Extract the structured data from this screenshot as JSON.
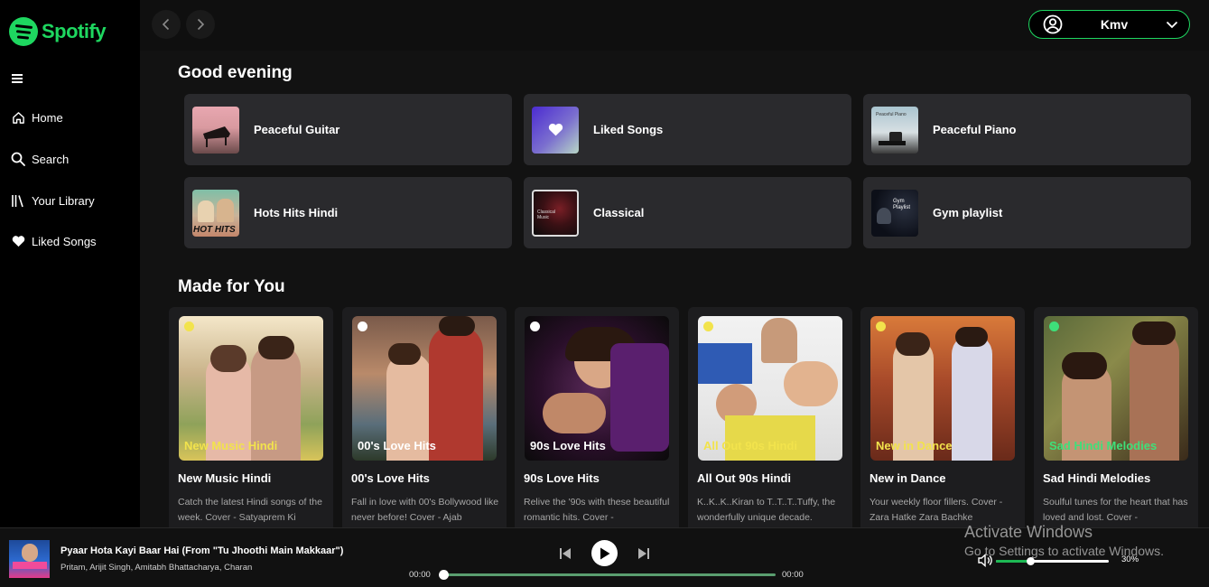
{
  "brand": {
    "name": "Spotify",
    "accent": "#1ed760"
  },
  "sidebar": {
    "items": [
      {
        "label": "Home",
        "icon": "home-icon"
      },
      {
        "label": "Search",
        "icon": "search-icon"
      },
      {
        "label": "Your Library",
        "icon": "library-icon"
      },
      {
        "label": "Liked Songs",
        "icon": "heart-icon"
      }
    ]
  },
  "header": {
    "user_name": "Kmv"
  },
  "greeting": "Good evening",
  "quick_picks": [
    {
      "label": "Peaceful Guitar"
    },
    {
      "label": "Liked Songs"
    },
    {
      "label": "Peaceful Piano",
      "art_text": "Peaceful Piano"
    },
    {
      "label": "Hots Hits Hindi",
      "art_text": "HOT HITS"
    },
    {
      "label": "Classical",
      "art_text": "Classical Music"
    },
    {
      "label": "Gym playlist",
      "art_text": "Gym Playlist"
    }
  ],
  "made_for_you": {
    "title": "Made for You",
    "cards": [
      {
        "title": "New Music Hindi",
        "overlay": "New Music Hindi",
        "overlay_color": "#f2e34c",
        "desc": "Catch the latest Hindi songs of the week. Cover - Satyaprem Ki"
      },
      {
        "title": "00's Love Hits",
        "overlay": "00's Love Hits",
        "overlay_color": "#ffffff",
        "desc": "Fall in love with 00's Bollywood like never before! Cover - Ajab"
      },
      {
        "title": "90s Love Hits",
        "overlay": "90s Love Hits",
        "overlay_color": "#ffffff",
        "desc": "Relive the '90s with these beautiful romantic hits. Cover -"
      },
      {
        "title": "All Out 90s Hindi",
        "overlay": "All Out 90s Hindi",
        "overlay_color": "#f2e34c",
        "desc": "K..K..K..Kiran to T..T..T..Tuffy, the wonderfully unique decade."
      },
      {
        "title": "New in Dance",
        "overlay": "New in Dance",
        "overlay_color": "#f2e34c",
        "desc": "Your weekly floor fillers. Cover - Zara Hatke Zara Bachke"
      },
      {
        "title": "Sad Hindi Melodies",
        "overlay": "Sad Hindi Melodies",
        "overlay_color": "#3ee07a",
        "desc": "Soulful tunes for the heart that has loved and lost. Cover -"
      }
    ]
  },
  "player": {
    "track_title": "Pyaar Hota Kayi Baar Hai (From \"Tu Jhoothi Main Makkaar\")",
    "artists": "Pritam, Arijit Singh, Amitabh Bhattacharya, Charan",
    "elapsed": "00:00",
    "duration": "00:00",
    "progress": 0,
    "volume_label": "30%",
    "volume": 0.3
  },
  "watermark": {
    "line1": "Activate Windows",
    "line2": "Go to Settings to activate Windows."
  }
}
